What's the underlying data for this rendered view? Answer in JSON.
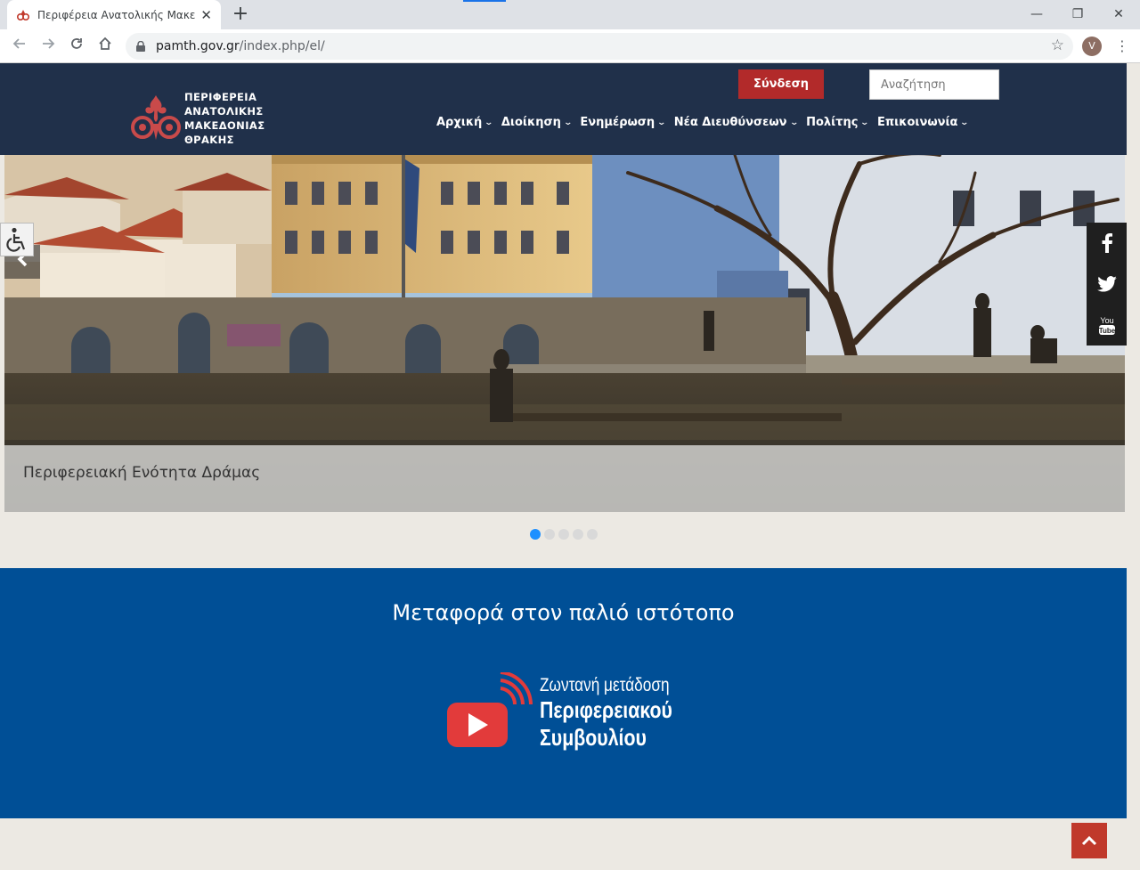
{
  "browser": {
    "tab_title": "Περιφέρεια Ανατολικής Μακεδο",
    "tab_close": "✕",
    "new_tab": "+",
    "url_host": "pamth.gov.gr",
    "url_path": "/index.php/el/",
    "profile_initial": "V",
    "window_controls": {
      "minimize": "—",
      "restore": "❐",
      "close": "✕"
    }
  },
  "header": {
    "logo_lines": [
      "ΠΕΡΙΦΕΡΕΙΑ",
      "ΑΝΑΤΟΛΙΚΗΣ",
      "ΜΑΚΕΔΟΝΙΑΣ",
      "ΘΡΑΚΗΣ"
    ],
    "login_label": "Σύνδεση",
    "search_placeholder": "Αναζήτηση",
    "nav": [
      {
        "label": "Αρχική"
      },
      {
        "label": "Διοίκηση"
      },
      {
        "label": "Ενημέρωση"
      },
      {
        "label": "Νέα Διευθύνσεων"
      },
      {
        "label": "Πολίτης"
      },
      {
        "label": "Επικοινωνία"
      }
    ],
    "colors": {
      "bar": "#20304a",
      "login": "#b22a2a"
    }
  },
  "slider": {
    "caption": "Περιφερειακή Ενότητα Δράμας",
    "slide_count": 5,
    "active_index": 0
  },
  "social": {
    "items": [
      {
        "name": "facebook-icon",
        "glyph": "f"
      },
      {
        "name": "twitter-icon",
        "glyph": "🐦"
      },
      {
        "name": "youtube-icon",
        "glyph": "You Tube"
      }
    ]
  },
  "promo": {
    "old_site_link": "Μεταφορά στον παλιό ιστότοπο",
    "live_line1": "Ζωντανή μετάδοση",
    "live_line2": "Περιφερειακού",
    "live_line3": "Συμβουλίου",
    "colors": {
      "section": "#004f96",
      "play": "#e23b3b"
    }
  }
}
